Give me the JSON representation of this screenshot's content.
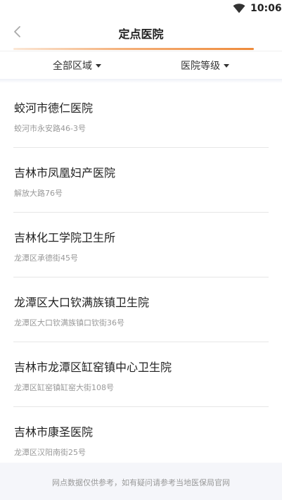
{
  "status_bar": {
    "time": "10:06",
    "wifi_icon": "wifi-icon"
  },
  "nav": {
    "back_icon": "chevron-left-icon",
    "title": "定点医院"
  },
  "filters": {
    "area_label": "全部区域",
    "level_label": "医院等级",
    "caret_icon": "caret-down-icon"
  },
  "hospitals": [
    {
      "name": "蛟河市德仁医院",
      "address": "蛟河市永安路46-3号"
    },
    {
      "name": "吉林市凤凰妇产医院",
      "address": "解放大路76号"
    },
    {
      "name": "吉林化工学院卫生所",
      "address": "龙潭区承德街45号"
    },
    {
      "name": "龙潭区大口钦满族镇卫生院",
      "address": "龙潭区大口钦满族镇口钦街36号"
    },
    {
      "name": "吉林市龙潭区缸窑镇中心卫生院",
      "address": "龙潭区缸窑镇缸窑大街108号"
    },
    {
      "name": "吉林市康圣医院",
      "address": "龙潭区汉阳南街25号"
    }
  ],
  "footer": {
    "note": "网点数据仅供参考，如有疑问请参考当地医保局官网"
  },
  "colors": {
    "accent": "#ee8a3a",
    "text": "#222222",
    "subtext": "#999999",
    "footer_bg": "#f5f6fa"
  }
}
